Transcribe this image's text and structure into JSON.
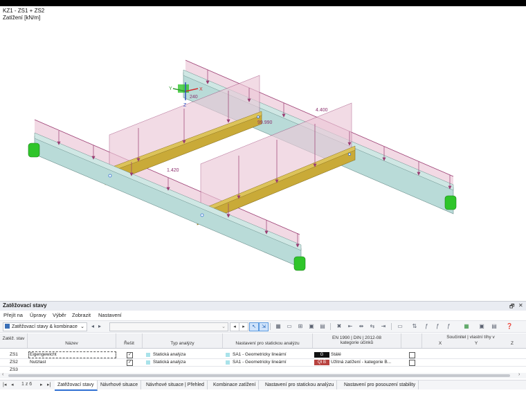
{
  "viewport": {
    "line1": "KZ1 - ZS1 + ZS2",
    "line2": "Zatížení [kN/m]",
    "labels": {
      "l_400": "4.400",
      "l_990": "99.990",
      "l_1420": "1.420",
      "l_240": "240"
    },
    "axis": {
      "x": "X",
      "y": "Y",
      "z": "Z"
    }
  },
  "panel": {
    "title": "Zatěžovací stavy",
    "ctrl_restore": "🗗",
    "ctrl_close": "✕"
  },
  "menu": [
    "Přejít na",
    "Úpravy",
    "Výběr",
    "Zobrazit",
    "Nastavení"
  ],
  "toolbar": {
    "combo_label": "Zatěžovací stavy & kombinace",
    "combo_arrow": "⌄",
    "second_combo_arrow": "⌄"
  },
  "grid": {
    "headers": {
      "zatez_stav": "Zatěž. stav",
      "nazev": "Název",
      "resit": "Řešit",
      "typ_analyzy": "Typ analýzy",
      "nastaveni": "Nastavení pro statickou analýzu",
      "en1990_line1": "EN 1990 | DIN | 2012-08",
      "en1990_line2": "kategorie účinků",
      "soucinitel": "Součinitel | vlastní tíhy v",
      "x": "X",
      "y": "Y",
      "z": "Z"
    },
    "rows": [
      {
        "id": "ZS1",
        "name": "Eigengewicht",
        "solve": "✓",
        "analysis": "Statická analýza",
        "settings": "SA1 - Geometricky lineární",
        "tag": "G",
        "tag_color": "#111111",
        "category": "Stálé",
        "selfweight": ""
      },
      {
        "id": "ZS2",
        "name": "Nutzlast",
        "solve": "✓",
        "analysis": "Statická analýza",
        "settings": "SA1 - Geometricky lineární",
        "tag": "QI B",
        "tag_color": "#b8423f",
        "category": "Užitná zatížení - kategorie B...",
        "selfweight": ""
      },
      {
        "id": "ZS3",
        "name": "",
        "solve": "",
        "analysis": "",
        "settings": "",
        "tag": "",
        "tag_color": "",
        "category": "",
        "selfweight": ""
      }
    ]
  },
  "status": {
    "pager": "1 z 6",
    "tabs": [
      "Zatěžovací stavy",
      "Návrhové situace",
      "Návrhové situace | Přehled",
      "Kombinace zatížení",
      "Nastavení pro statickou analýzu",
      "Nastavení pro posouzení stability"
    ]
  },
  "colors": {
    "beam_main": "#b9dbd8",
    "beam_secondary": "#c9aa38",
    "load_fill": "#e9c3d3",
    "load_line": "#9a3d72",
    "support": "#2fc52a",
    "accent": "#2f6fd2"
  }
}
